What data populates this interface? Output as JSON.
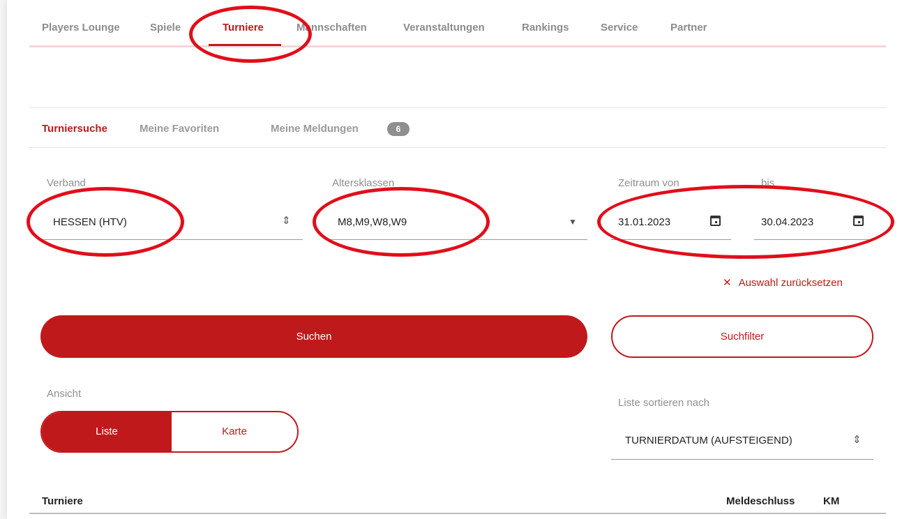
{
  "topnav": {
    "items": [
      "Players Lounge",
      "Spiele",
      "Turniere",
      "Mannschaften",
      "Veranstaltungen",
      "Rankings",
      "Service",
      "Partner"
    ],
    "active": "Turniere"
  },
  "subnav": {
    "items": [
      "Turniersuche",
      "Meine Favoriten",
      "Meine Meldungen"
    ],
    "badge": "6"
  },
  "filters": {
    "verband_label": "Verband",
    "verband_value": "HESSEN (HTV)",
    "altersklassen_label": "Altersklassen",
    "altersklassen_value": "M8,M9,W8,W9",
    "zeitraum_label": "Zeitraum von",
    "zeitraum_from": "31.01.2023",
    "bis_label": "bis",
    "zeitraum_to": "30.04.2023",
    "reset_label": "Auswahl zurücksetzen"
  },
  "buttons": {
    "search": "Suchen",
    "filter": "Suchfilter"
  },
  "view": {
    "label": "Ansicht",
    "options": [
      "Liste",
      "Karte"
    ],
    "selected": "Liste"
  },
  "sort": {
    "label": "Liste sortieren nach",
    "value": "TURNIERDATUM (AUFSTEIGEND)"
  },
  "list": {
    "headers": [
      "Turniere",
      "Meldeschluss",
      "KM"
    ]
  },
  "colors": {
    "accent": "#c0191b",
    "annotation": "#e10e1a"
  },
  "icons": {
    "select": "sort-arrows-icon",
    "dropdown": "caret-down-icon",
    "date": "calendar-icon",
    "reset": "close-icon"
  }
}
